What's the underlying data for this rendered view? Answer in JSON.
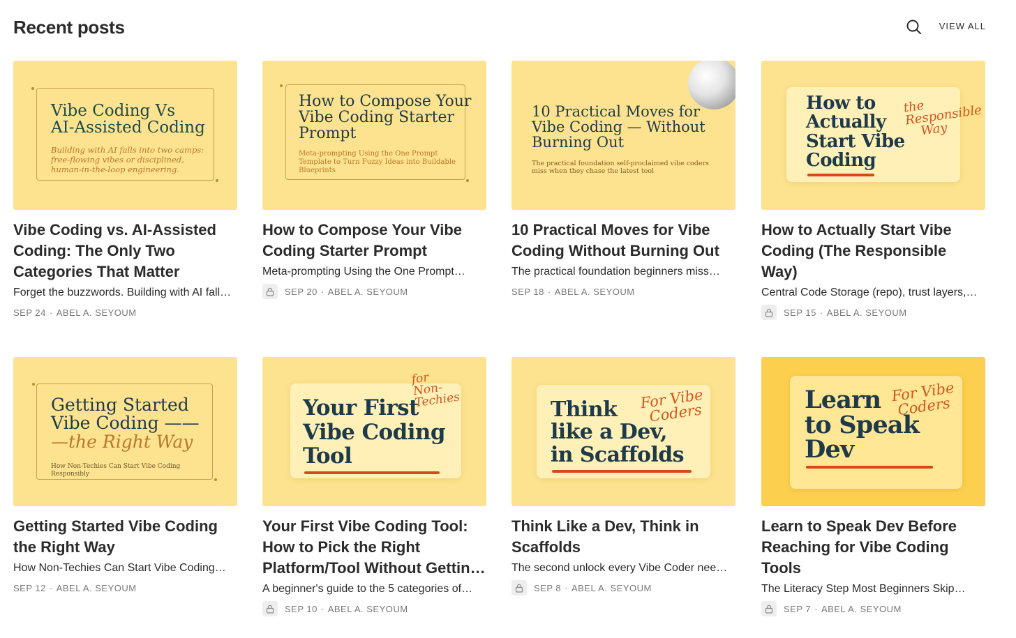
{
  "header": {
    "title": "Recent posts",
    "view_all": "VIEW ALL"
  },
  "meta_sep": "·",
  "posts": [
    {
      "title": "Vibe Coding vs. AI-Assisted Coding: The Only Two Categories That Matter",
      "subtitle": "Forget the buzzwords. Building with AI fall…",
      "date": "SEP 24",
      "author": "ABEL A. SEYOUM",
      "locked": false,
      "thumb": {
        "line1": "Vibe Coding Vs",
        "line2": "AI-Assisted Coding",
        "sub": "Building with AI falls into two camps: free-flowing vibes or disciplined, human-in-the-loop engineering."
      }
    },
    {
      "title": "How to Compose Your Vibe Coding Starter Prompt",
      "subtitle": "Meta-prompting Using the One Prompt…",
      "date": "SEP 20",
      "author": "ABEL A. SEYOUM",
      "locked": true,
      "thumb": {
        "line1": "How to Compose Your",
        "line2": "Vibe Coding Starter",
        "line3": "Prompt",
        "sub": "Meta-prompting Using the One Prompt Template to Turn Fuzzy Ideas into Buildable Blueprints"
      }
    },
    {
      "title": "10 Practical Moves for Vibe Coding Without Burning Out",
      "subtitle": "The practical foundation beginners miss…",
      "date": "SEP 18",
      "author": "ABEL A. SEYOUM",
      "locked": false,
      "thumb": {
        "line1": "10 Practical Moves for",
        "line2": "Vibe Coding — Without",
        "line3": "Burning Out",
        "sub": "The practical foundation self-proclaimed vibe coders miss when they chase the latest tool"
      }
    },
    {
      "title": "How to Actually Start Vibe Coding (The Responsible Way)",
      "subtitle": "Central Code Storage (repo), trust layers,…",
      "date": "SEP 15",
      "author": "ABEL A. SEYOUM",
      "locked": true,
      "thumb": {
        "line1": "How to",
        "line2": "Actually",
        "line3": "Start Vibe",
        "line4": "Coding",
        "script1": "the",
        "script2": "Responsible",
        "script3": "Way"
      }
    },
    {
      "title": "Getting Started Vibe Coding the Right Way",
      "subtitle": "How Non-Techies Can Start Vibe Coding…",
      "date": "SEP 12",
      "author": "ABEL A. SEYOUM",
      "locked": false,
      "thumb": {
        "line1": "Getting Started",
        "line2": "Vibe Coding ——",
        "line3": "—the Right Way",
        "sub": "How Non-Techies Can Start Vibe Coding Responsibly"
      }
    },
    {
      "title": "Your First Vibe Coding Tool: How to Pick the Right Platform/Tool Without Gettin…",
      "subtitle": "A beginner's guide to the 5 categories of…",
      "date": "SEP 10",
      "author": "ABEL A. SEYOUM",
      "locked": true,
      "thumb": {
        "line1": "Your First",
        "line2": "Vibe Coding",
        "line3": "Tool",
        "script1": "for",
        "script2": "Non-",
        "script3": "Techies"
      }
    },
    {
      "title": "Think Like a Dev, Think in Scaffolds",
      "subtitle": "The second unlock every Vibe Coder nee…",
      "date": "SEP 8",
      "author": "ABEL A. SEYOUM",
      "locked": true,
      "thumb": {
        "line1": "Think",
        "line2": "like a Dev,",
        "line3": "in Scaffolds",
        "script1": "For Vibe",
        "script2": "Coders"
      }
    },
    {
      "title": "Learn to Speak Dev Before Reaching for Vibe Coding Tools",
      "subtitle": "The Literacy Step Most Beginners Skip…",
      "date": "SEP 7",
      "author": "ABEL A. SEYOUM",
      "locked": true,
      "thumb": {
        "line1": "Learn",
        "line2": "to Speak",
        "line3": "Dev",
        "script1": "For Vibe",
        "script2": "Coders"
      }
    }
  ]
}
